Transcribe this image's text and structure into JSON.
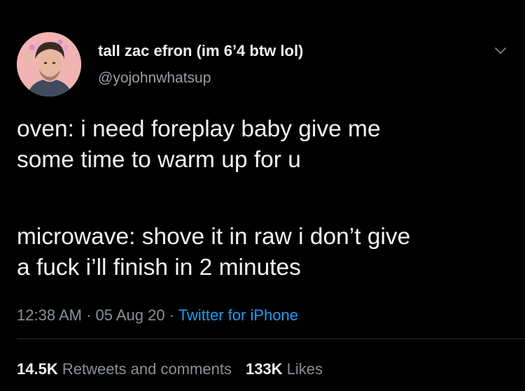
{
  "author": {
    "name": "tall zac efron (im 6’4 btw lol)",
    "handle": "@yojohnwhatsup",
    "avatar_icon": "profile-photo-avatar"
  },
  "tweet": {
    "paragraphs": [
      "oven: i need foreplay baby give me",
      "some time to warm up for u",
      "microwave: shove it in raw i don’t give",
      "a fuck i’ll finish in 2 minutes"
    ]
  },
  "meta": {
    "time": "12:38 AM",
    "separator": " · ",
    "date": "05 Aug 20",
    "source": "Twitter for iPhone"
  },
  "stats": {
    "retweets_count": "14.5K",
    "retweets_label": "Retweets and comments",
    "likes_count": "133K",
    "likes_label": "Likes"
  },
  "colors": {
    "background": "#000000",
    "link": "#1d9bf0",
    "secondary_text": "#8b9095"
  }
}
